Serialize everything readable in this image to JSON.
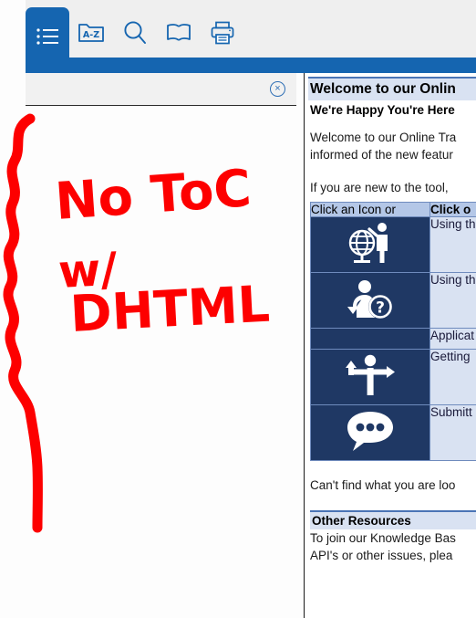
{
  "toolbar": {
    "buttons": [
      {
        "name": "contents-icon",
        "label": "Contents",
        "active": true
      },
      {
        "name": "index-icon",
        "label": "Index",
        "active": false
      },
      {
        "name": "search-icon",
        "label": "Search",
        "active": false
      },
      {
        "name": "glossary-icon",
        "label": "Glossary",
        "active": false
      },
      {
        "name": "print-icon",
        "label": "Print",
        "active": false
      }
    ],
    "index_icon_text": "A-Z"
  },
  "nav_pane": {
    "close_label": "×",
    "contents": ""
  },
  "content": {
    "title": "Welcome to our Onlin",
    "subtitle": "We're Happy You're Here",
    "paragraph1_line1": "Welcome to our Online Tra",
    "paragraph1_line2": "informed of the new featur",
    "paragraph2_line1": "If you are new to the tool,",
    "table": {
      "header_left": "Click an Icon or",
      "header_right": "Click o",
      "rows": [
        {
          "icon": "globe-person-icon",
          "desc": "Using th"
        },
        {
          "icon": "question-person-icon",
          "desc": "Using th"
        },
        {
          "icon": "none",
          "desc": "Applicat"
        },
        {
          "icon": "direction-person-icon",
          "desc": "Getting"
        },
        {
          "icon": "speech-bubble-icon",
          "desc": "Submitt"
        }
      ]
    },
    "closing_line": "Can't find what you are loo",
    "resources_title": "Other Resources",
    "resources_line1": "To join our Knowledge Bas",
    "resources_line2": "API's or other issues, plea"
  },
  "annotation": {
    "line1": "No ToC",
    "line2": "w/",
    "line3": "DHTML",
    "color": "#fd0000"
  },
  "colors": {
    "toolbar_bg": "#efefef",
    "accent_blue": "#1565b0",
    "table_header": "#b4c7e7",
    "table_icon_bg": "#1f3864",
    "table_desc_bg": "#d9e2f2",
    "title_bg": "#d9e2f2"
  }
}
